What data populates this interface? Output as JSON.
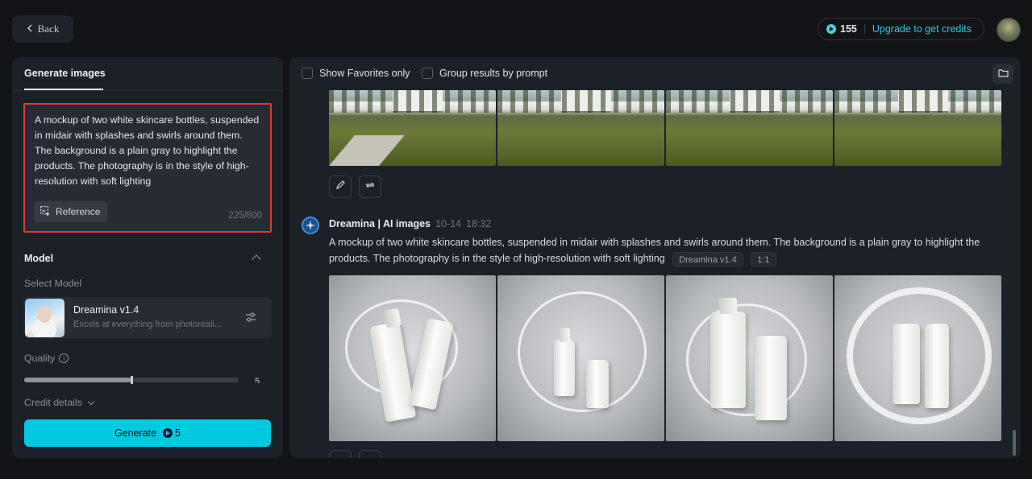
{
  "topbar": {
    "back_label": "Back",
    "credits_count": "155",
    "upgrade_label": "Upgrade to get credits"
  },
  "left": {
    "tab_label": "Generate images",
    "prompt_text": "A mockup of two white skincare bottles, suspended in midair with splashes and swirls around them. The background is a plain gray to highlight the products. The photography is in the style of high-resolution with soft lighting",
    "reference_label": "Reference",
    "char_counter": "225/800",
    "model_section_title": "Model",
    "select_model_label": "Select Model",
    "model_name": "Dreamina v1.4",
    "model_desc": "Excels at everything from photoreali...",
    "quality_label": "Quality",
    "quality_value": "5",
    "quality_level": 0.5,
    "credit_details_label": "Credit details",
    "generate_label": "Generate",
    "generate_cost": "5"
  },
  "right": {
    "show_favorites_label": "Show Favorites only",
    "group_results_label": "Group results by prompt",
    "message": {
      "author": "Dreamina | AI images",
      "date": "10-14",
      "time": "18:32",
      "prompt": "A mockup of two white skincare bottles, suspended in midair with splashes and swirls around them. The background is a plain gray to highlight the products. The photography is in the style of high-resolution with soft lighting",
      "model_tag": "Dreamina v1.4",
      "ratio_tag": "1:1"
    }
  },
  "icons": [
    "chevron-left-icon",
    "coin-icon",
    "image-plus-icon",
    "chevron-up-icon",
    "sliders-icon",
    "info-icon",
    "chevron-down-icon",
    "folder-icon",
    "edit-icon",
    "regenerate-icon",
    "dreamina-star-icon"
  ],
  "colors": {
    "accent": "#00c8e0",
    "highlight_border": "#e23b3b",
    "panel_bg": "#1c2027",
    "page_bg": "#111317"
  }
}
